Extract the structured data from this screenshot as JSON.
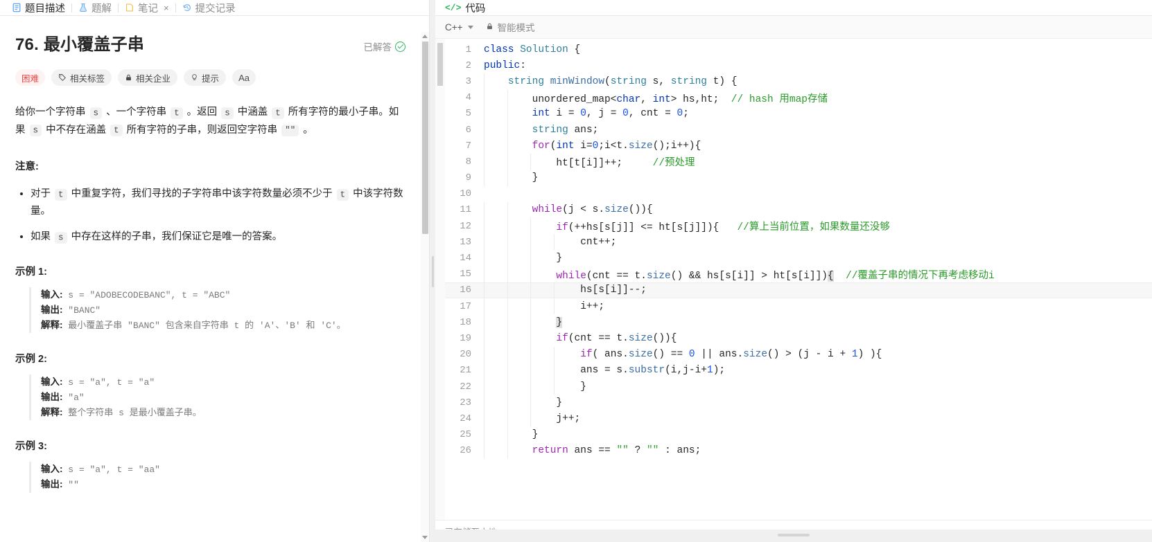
{
  "left_panel": {
    "tabs": [
      {
        "label": "题目描述",
        "icon": "document-icon",
        "active": true,
        "closable": false
      },
      {
        "label": "题解",
        "icon": "flask-icon",
        "active": false,
        "closable": false
      },
      {
        "label": "笔记",
        "icon": "note-icon",
        "active": false,
        "closable": true,
        "close_label": "×"
      },
      {
        "label": "提交记录",
        "icon": "history-icon",
        "active": false,
        "closable": false
      }
    ],
    "question": {
      "number": "76.",
      "title": "最小覆盖子串",
      "full_title": "76. 最小覆盖子串",
      "solved_badge": "已解答",
      "chips": [
        {
          "label": "困难",
          "icon": null,
          "style": "hard"
        },
        {
          "label": "相关标签",
          "icon": "tag-icon",
          "style": "normal"
        },
        {
          "label": "相关企业",
          "icon": "lock-icon",
          "style": "normal"
        },
        {
          "label": "提示",
          "icon": "bulb-icon",
          "style": "normal"
        },
        {
          "label": "Aa",
          "icon": "font-size-icon",
          "style": "icononly"
        }
      ],
      "description_parts": [
        {
          "t": "给你一个字符串 "
        },
        {
          "t": "s",
          "code": true
        },
        {
          "t": " 、一个字符串 "
        },
        {
          "t": "t",
          "code": true
        },
        {
          "t": " 。返回 "
        },
        {
          "t": "s",
          "code": true
        },
        {
          "t": " 中涵盖 "
        },
        {
          "t": "t",
          "code": true
        },
        {
          "t": " 所有字符的最小子串。如果 "
        },
        {
          "t": "s",
          "code": true
        },
        {
          "t": " 中不存在涵盖 "
        },
        {
          "t": "t",
          "code": true
        },
        {
          "t": " 所有字符的子串，则返回空字符串 "
        },
        {
          "t": "\"\"",
          "code": true
        },
        {
          "t": " 。"
        }
      ],
      "notes_heading": "注意:",
      "notes": [
        [
          {
            "t": "对于 "
          },
          {
            "t": "t",
            "code": true
          },
          {
            "t": " 中重复字符，我们寻找的子字符串中该字符数量必须不少于 "
          },
          {
            "t": "t",
            "code": true
          },
          {
            "t": " 中该字符数量。"
          }
        ],
        [
          {
            "t": "如果 "
          },
          {
            "t": "s",
            "code": true
          },
          {
            "t": " 中存在这样的子串，我们保证它是唯一的答案。"
          }
        ]
      ],
      "examples": [
        {
          "heading": "示例 1:",
          "rows": [
            {
              "label": "输入:",
              "value": " s = \"ADOBECODEBANC\", t = \"ABC\""
            },
            {
              "label": "输出:",
              "value": " \"BANC\""
            },
            {
              "label": "解释:",
              "value": " 最小覆盖子串 \"BANC\" 包含来自字符串 t 的 'A'、'B' 和 'C'。"
            }
          ]
        },
        {
          "heading": "示例 2:",
          "rows": [
            {
              "label": "输入:",
              "value": " s = \"a\", t = \"a\""
            },
            {
              "label": "输出:",
              "value": " \"a\""
            },
            {
              "label": "解释:",
              "value": " 整个字符串 s 是最小覆盖子串。"
            }
          ]
        },
        {
          "heading": "示例 3:",
          "rows": [
            {
              "label": "输入:",
              "value": " s = \"a\", t = \"aa\""
            },
            {
              "label": "输出:",
              "value": " \"\""
            }
          ]
        }
      ]
    }
  },
  "right_panel": {
    "tab_label": "代码",
    "tab_icon": "code-brackets-icon",
    "language": "C++",
    "mode_label": "智能模式",
    "mode_icon": "lock-icon",
    "status_text": "已存储至本地",
    "highlighted_line": 16,
    "code_lines": [
      {
        "n": 1,
        "indent": 0,
        "html": "<span class=\"kw\">class</span> <span class=\"typ\">Solution</span> {"
      },
      {
        "n": 2,
        "indent": 0,
        "html": "<span class=\"kw\">public</span>:"
      },
      {
        "n": 3,
        "indent": 1,
        "html": "    <span class=\"typ\">string</span> <span class=\"fn\">minWindow</span>(<span class=\"typ\">string</span> s, <span class=\"typ\">string</span> t) {"
      },
      {
        "n": 4,
        "indent": 2,
        "html": "        unordered_map&lt;<span class=\"kw\">char</span>, <span class=\"kw\">int</span>&gt; hs,ht;  <span class=\"cmt\">// hash 用map存储</span>"
      },
      {
        "n": 5,
        "indent": 2,
        "html": "        <span class=\"kw\">int</span> i = <span class=\"num\">0</span>, j = <span class=\"num\">0</span>, cnt = <span class=\"num\">0</span>;"
      },
      {
        "n": 6,
        "indent": 2,
        "html": "        <span class=\"typ\">string</span> ans;"
      },
      {
        "n": 7,
        "indent": 2,
        "html": "        <span class=\"kw2\">for</span>(<span class=\"kw\">int</span> i=<span class=\"num\">0</span>;i&lt;t.<span class=\"fn\">size</span>();i++){"
      },
      {
        "n": 8,
        "indent": 3,
        "html": "            ht[t[i]]++;     <span class=\"cmt\">//预处理</span>"
      },
      {
        "n": 9,
        "indent": 2,
        "html": "        }"
      },
      {
        "n": 10,
        "indent": 0,
        "html": ""
      },
      {
        "n": 11,
        "indent": 2,
        "html": "        <span class=\"kw2\">while</span>(j &lt; s.<span class=\"fn\">size</span>()){"
      },
      {
        "n": 12,
        "indent": 3,
        "html": "            <span class=\"kw2\">if</span>(++hs[s[j]] &lt;= ht[s[j]]){   <span class=\"cmt\">//算上当前位置，如果数量还没够</span>"
      },
      {
        "n": 13,
        "indent": 4,
        "html": "                cnt++;"
      },
      {
        "n": 14,
        "indent": 3,
        "html": "            }"
      },
      {
        "n": 15,
        "indent": 3,
        "html": "            <span class=\"kw2\">while</span>(cnt == t.<span class=\"fn\">size</span>() &amp;&amp; hs[s[i]] &gt; ht[s[i]])<span class=\"brmatch\">{</span>  <span class=\"cmt\">//覆盖子串的情况下再考虑移动i</span>"
      },
      {
        "n": 16,
        "indent": 4,
        "html": "                hs[s[i]]--;"
      },
      {
        "n": 17,
        "indent": 4,
        "html": "                i++;"
      },
      {
        "n": 18,
        "indent": 3,
        "html": "            <span class=\"brmatch\">}</span>"
      },
      {
        "n": 19,
        "indent": 3,
        "html": "            <span class=\"kw2\">if</span>(cnt == t.<span class=\"fn\">size</span>()){"
      },
      {
        "n": 20,
        "indent": 4,
        "html": "                <span class=\"kw2\">if</span>( ans.<span class=\"fn\">size</span>() == <span class=\"num\">0</span> || ans.<span class=\"fn\">size</span>() &gt; (j - i + <span class=\"num\">1</span>) ){"
      },
      {
        "n": 21,
        "indent": 4,
        "html": "                ans = s.<span class=\"fn\">substr</span>(i,j-i+<span class=\"num\">1</span>);"
      },
      {
        "n": 22,
        "indent": 4,
        "html": "                }"
      },
      {
        "n": 23,
        "indent": 3,
        "html": "            }"
      },
      {
        "n": 24,
        "indent": 3,
        "html": "            j++;"
      },
      {
        "n": 25,
        "indent": 2,
        "html": "        }"
      },
      {
        "n": 26,
        "indent": 2,
        "html": "        <span class=\"kw2\">return</span> ans == <span class=\"str\">\"\"</span> ? <span class=\"str\">\"\"</span> : ans;"
      }
    ]
  },
  "colors": {
    "accent_green": "#2db55d",
    "hard_red": "#ef4743",
    "keyword_blue": "#0033b3",
    "keyword_purple": "#9c27b0",
    "comment_green": "#2a9b2a",
    "type_teal": "#2d7f9d"
  }
}
